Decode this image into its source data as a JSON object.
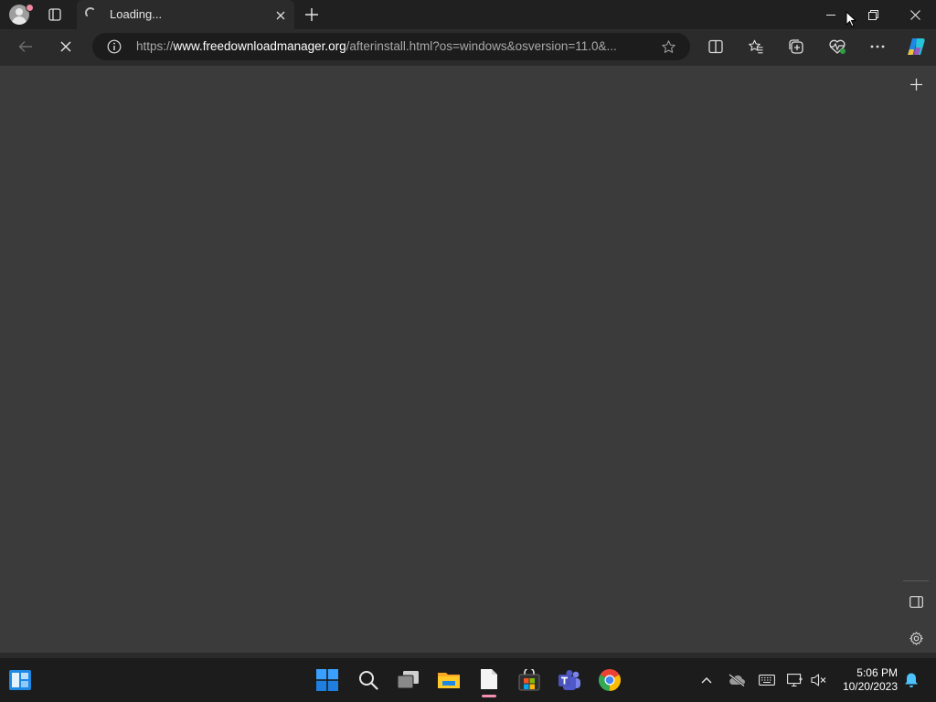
{
  "browser": {
    "tab": {
      "title": "Loading..."
    },
    "address_bar": {
      "url_prefix": "https://",
      "url_domain": "www.freedownloadmanager.org",
      "url_path": "/afterinstall.html?os=windows&osversion=11.0&..."
    }
  },
  "taskbar": {
    "clock": {
      "time": "5:06 PM",
      "date": "10/20/2023"
    },
    "apps": [
      "widgets",
      "start",
      "search",
      "task-view",
      "file-explorer",
      "notepad",
      "microsoft-store",
      "teams",
      "chrome"
    ],
    "tray": [
      "chevron-up",
      "onedrive",
      "keyboard",
      "network",
      "volume-muted",
      "notifications"
    ]
  },
  "colors": {
    "titlebar": "#202020",
    "toolbar": "#2b2b2b",
    "content": "#3b3b3b",
    "taskbar": "#1c1c1c",
    "accent": "#4cc2ff"
  }
}
